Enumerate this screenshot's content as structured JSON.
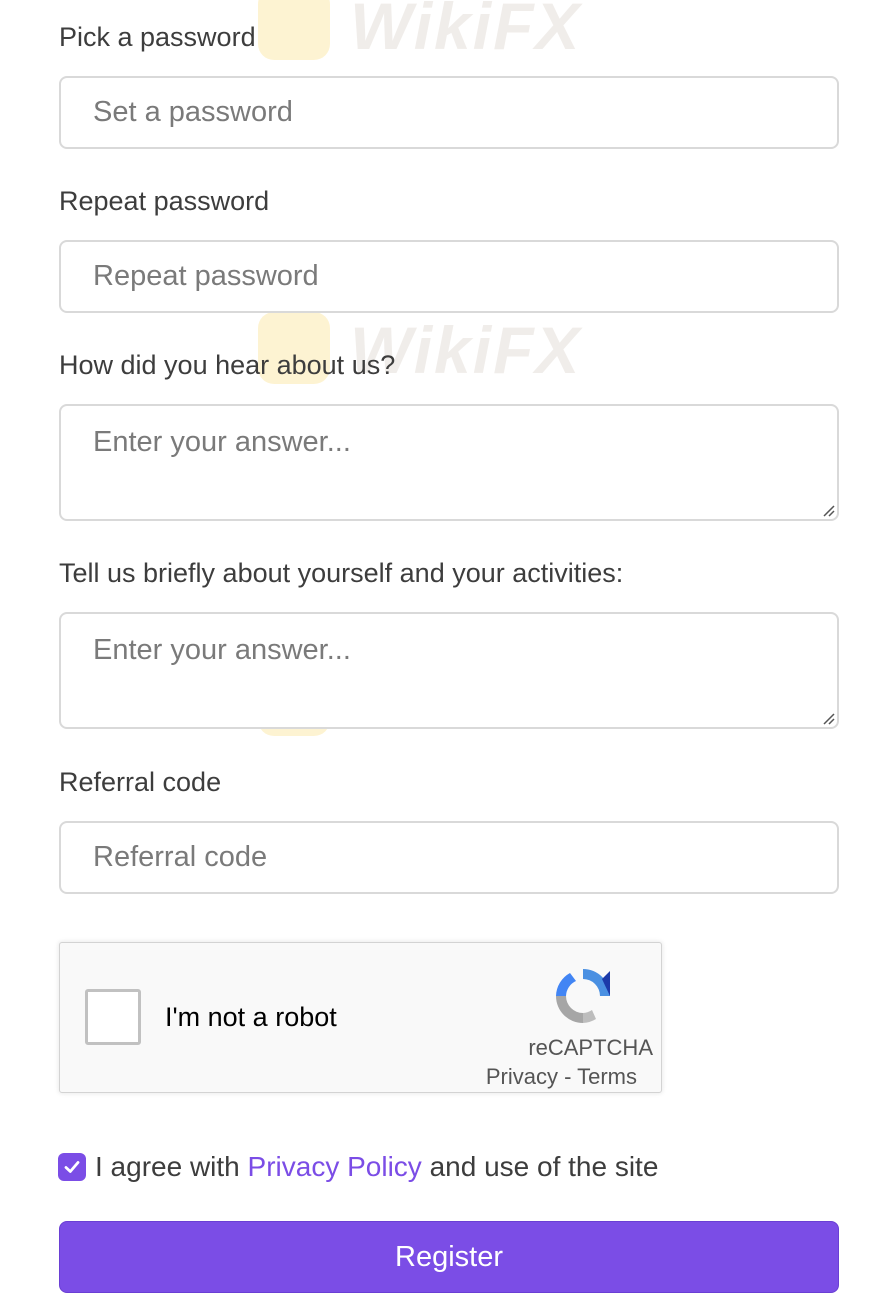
{
  "form": {
    "password_label": "Pick a password",
    "password_placeholder": "Set a password",
    "repeat_label": "Repeat password",
    "repeat_placeholder": "Repeat password",
    "hear_label": "How did you hear about us?",
    "hear_placeholder": "Enter your answer...",
    "about_label": "Tell us briefly about yourself and your activities:",
    "about_placeholder": "Enter your answer...",
    "referral_label": "Referral code",
    "referral_placeholder": "Referral code"
  },
  "recaptcha": {
    "checkbox_label": "I'm not a robot",
    "brand": "reCAPTCHA",
    "links": "Privacy - Terms",
    "checked": false
  },
  "agreement": {
    "checked": true,
    "prefix": "I agree with ",
    "link_text": "Privacy Policy",
    "suffix": " and use of the site"
  },
  "register_button": "Register",
  "watermark": {
    "text": "WikiFX"
  },
  "colors": {
    "accent": "#7b4de6",
    "border": "#d9d9d9",
    "watermark_logo": "#fde9a6"
  },
  "icons": [
    "check-icon",
    "recaptcha-logo-icon",
    "resize-grip-icon"
  ]
}
